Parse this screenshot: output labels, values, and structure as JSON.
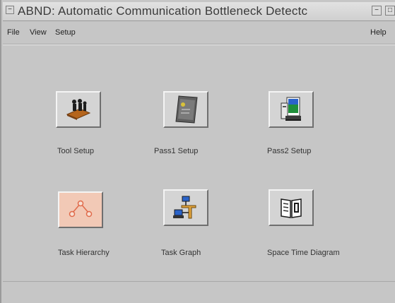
{
  "window": {
    "title": "ABND: Automatic Communication Bottleneck Detectc",
    "system_menu_glyph": "−",
    "minimize_glyph": "−",
    "maximize_glyph": "□"
  },
  "menubar": {
    "file": "File",
    "view": "View",
    "setup": "Setup",
    "help": "Help"
  },
  "tools": [
    {
      "label": "Tool Setup",
      "icon": "people-icon"
    },
    {
      "label": "Pass1 Setup",
      "icon": "device-icon"
    },
    {
      "label": "Pass2 Setup",
      "icon": "computer-icon"
    },
    {
      "label": "Task Hierarchy",
      "icon": "tree-icon"
    },
    {
      "label": "Task Graph",
      "icon": "network-icon"
    },
    {
      "label": "Space Time Diagram",
      "icon": "book-icon"
    }
  ],
  "colors": {
    "background": "#c6c6c6",
    "tree_tile_background": "#f2c9b6",
    "tree_lines": "#e06a4a"
  }
}
